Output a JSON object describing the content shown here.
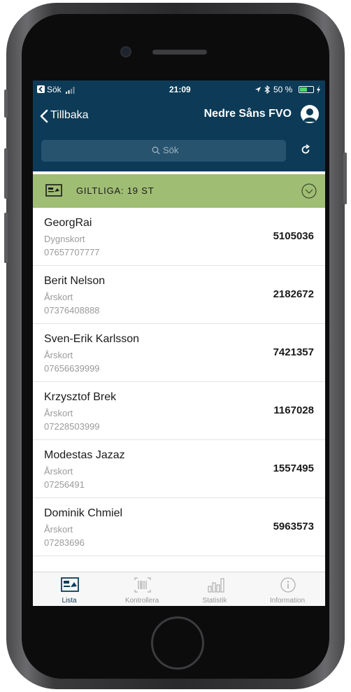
{
  "statusbar": {
    "carrier": "Sök",
    "time": "21:09",
    "battery": "50 %"
  },
  "navbar": {
    "back_label": "Tillbaka",
    "title": "Nedre Såns FVO"
  },
  "search": {
    "placeholder": "Sök"
  },
  "section": {
    "title": "GILTLIGA: 19 ST"
  },
  "items": [
    {
      "name": "GeorgRai",
      "type": "Dygnskort",
      "phone": "07657707777",
      "code": "5105036"
    },
    {
      "name": "Berit Nelson",
      "type": "Årskort",
      "phone": "07376408888",
      "code": "2182672"
    },
    {
      "name": "Sven-Erik Karlsson",
      "type": "Årskort",
      "phone": "07656639999",
      "code": "7421357"
    },
    {
      "name": "Krzysztof Brek",
      "type": "Årskort",
      "phone": "07228503999",
      "code": "1167028"
    },
    {
      "name": "Modestas Jazaz",
      "type": "Årskort",
      "phone": "07256491",
      "code": "1557495"
    },
    {
      "name": "Dominik Chmiel",
      "type": "Årskort",
      "phone": "07283696",
      "code": "5963573"
    }
  ],
  "tabs": [
    {
      "label": "Lista",
      "icon": "list-card-icon"
    },
    {
      "label": "Kontrollera",
      "icon": "barcode-icon"
    },
    {
      "label": "Statistik",
      "icon": "bar-chart-icon"
    },
    {
      "label": "Information",
      "icon": "info-icon"
    }
  ],
  "colors": {
    "navbar": "#0d3b57",
    "section": "#a0bd74",
    "active_tab": "#0d3b57"
  }
}
